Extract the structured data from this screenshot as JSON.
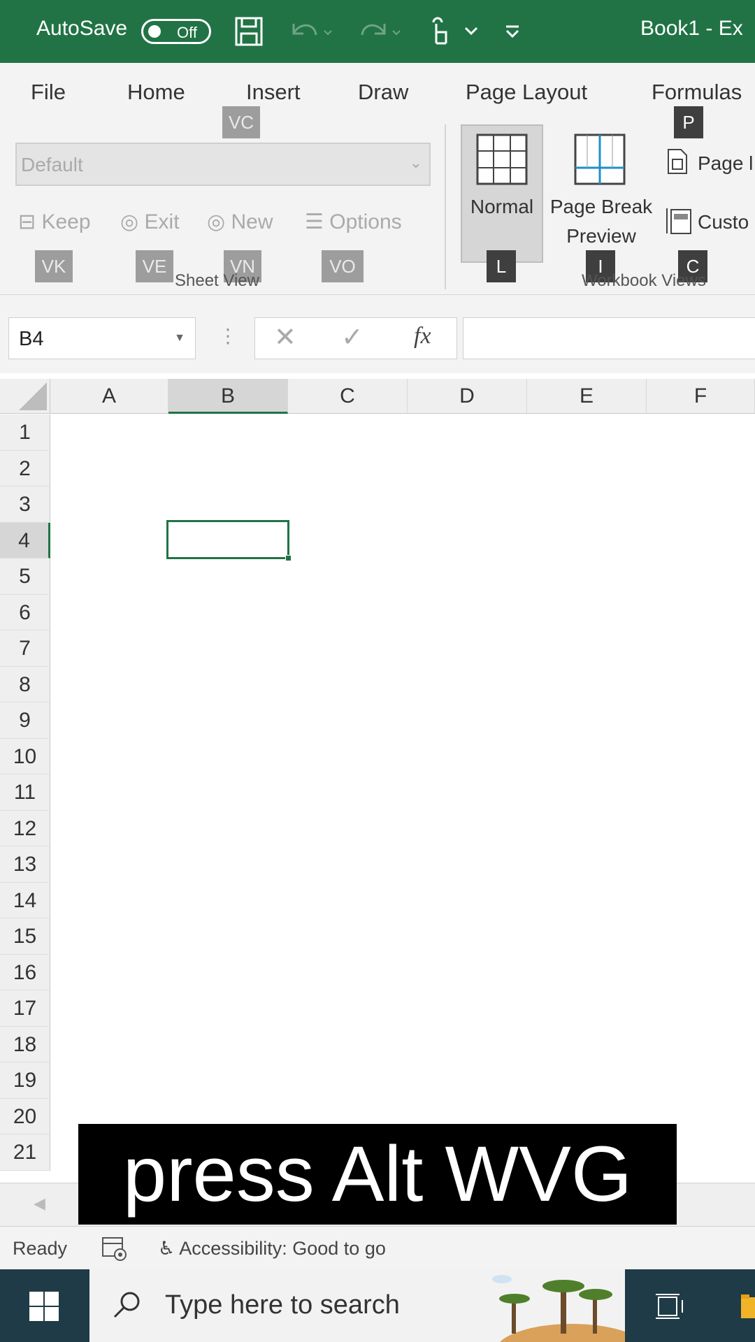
{
  "titlebar": {
    "autosave_label": "AutoSave",
    "autosave_state": "Off",
    "doc_title": "Book1  -  Ex",
    "bg_color": "#217346"
  },
  "ribbon": {
    "tabs": [
      "File",
      "Home",
      "Insert",
      "Draw",
      "Page Layout",
      "Formulas"
    ],
    "keytips": {
      "insert": "VC",
      "formulas": "P",
      "keep": "VK",
      "exit": "VE",
      "new": "VN",
      "options": "VO",
      "normal": "L",
      "page_break": "I",
      "custom": "C"
    },
    "sheet_view": {
      "select_value": "Default",
      "buttons": [
        "Keep",
        "Exit",
        "New",
        "Options"
      ],
      "group_label": "Sheet View"
    },
    "workbook_views": {
      "normal": "Normal",
      "page_break_1": "Page Break",
      "page_break_2": "Preview",
      "page_layout": "Page l",
      "custom": "Custo",
      "group_label": "Workbook Views"
    }
  },
  "formula_bar": {
    "name_box": "B4",
    "fx": "fx",
    "content": ""
  },
  "grid": {
    "columns": [
      "A",
      "B",
      "C",
      "D",
      "E",
      "F"
    ],
    "rows": [
      "1",
      "2",
      "3",
      "4",
      "5",
      "6",
      "7",
      "8",
      "9",
      "10",
      "11",
      "12",
      "13",
      "14",
      "15",
      "16",
      "17",
      "18",
      "19",
      "20",
      "21"
    ],
    "selected_cell": "B4",
    "accent_color": "#217346"
  },
  "status": {
    "ready": "Ready",
    "accessibility": "Accessibility: Good to go"
  },
  "taskbar": {
    "search_placeholder": "Type here to search"
  },
  "caption": "press Alt WVG"
}
